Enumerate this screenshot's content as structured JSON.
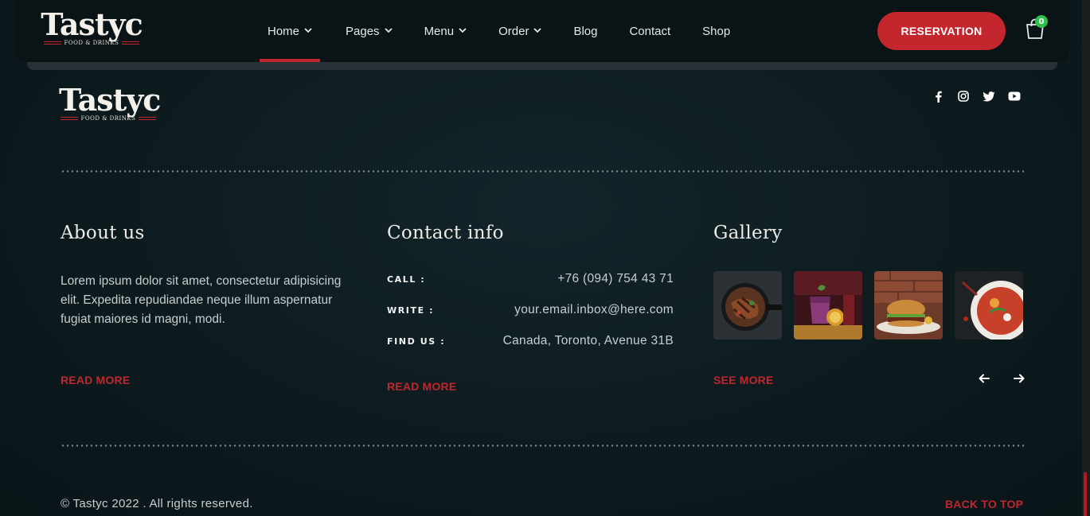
{
  "brand": {
    "name": "Tastyc",
    "tagline": "FOOD & DRINKS",
    "accent": "#c4262d"
  },
  "nav": {
    "items": [
      {
        "label": "Home",
        "dropdown": true,
        "active": true
      },
      {
        "label": "Pages",
        "dropdown": true
      },
      {
        "label": "Menu",
        "dropdown": true
      },
      {
        "label": "Order",
        "dropdown": true
      },
      {
        "label": "Blog",
        "dropdown": false
      },
      {
        "label": "Contact",
        "dropdown": false
      },
      {
        "label": "Shop",
        "dropdown": false
      }
    ],
    "reservation_label": "RESERVATION",
    "cart_count": "0"
  },
  "socials": [
    "facebook-icon",
    "instagram-icon",
    "twitter-icon",
    "youtube-icon"
  ],
  "about": {
    "title": "About us",
    "text": "Lorem ipsum dolor sit amet, consectetur adipisicing elit. Expedita repudiandae neque illum aspernatur fugiat maiores id magni, modi.",
    "link": "READ MORE"
  },
  "contact": {
    "title": "Contact info",
    "rows": [
      {
        "label": "CALL :",
        "value": "+76 (094) 754 43 71"
      },
      {
        "label": "WRITE :",
        "value": "your.email.inbox@here.com"
      },
      {
        "label": "FIND US :",
        "value": "Canada, Toronto, Avenue 31B"
      }
    ],
    "link": "READ MORE"
  },
  "gallery": {
    "title": "Gallery",
    "link": "SEE MORE",
    "images": [
      "grilled-meat-skillet-image",
      "cocktail-drink-image",
      "burger-image",
      "soup-bowl-image"
    ],
    "prev_icon": "arrow-left-icon",
    "next_icon": "arrow-right-icon"
  },
  "footer": {
    "copyright": "© Tastyc 2022 . All rights reserved.",
    "back_to_top": "BACK TO TOP"
  }
}
